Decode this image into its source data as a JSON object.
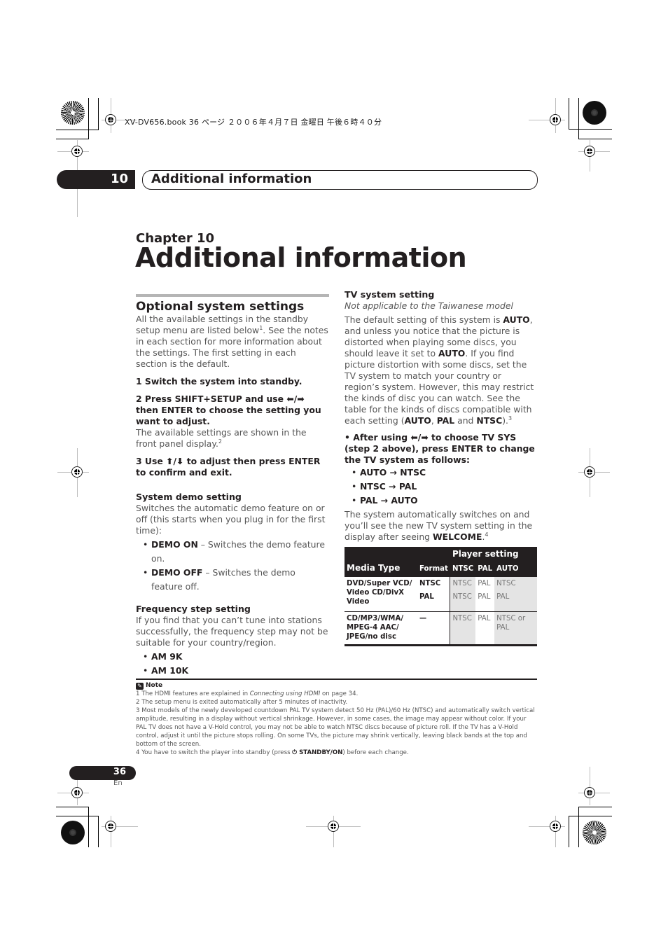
{
  "print_header": "XV-DV656.book  36 ページ  ２００６年４月７日  金曜日  午後６時４０分",
  "chapter_tab": {
    "number": "10",
    "title": "Additional information"
  },
  "chapter_heading": {
    "label": "Chapter 10",
    "title": "Additional information"
  },
  "left_column": {
    "section_title": "Optional system settings",
    "intro_a": "All the available settings in the standby setup menu are listed below",
    "intro_sup": "1",
    "intro_b": ". See the notes in each section for more information about the settings. The first setting in each section is the default.",
    "step1": "1    Switch the system into standby.",
    "step2": "2    Press SHIFT+SETUP and use ⬅/➡ then ENTER to choose the setting you want to adjust.",
    "step2_note_a": "The available settings are shown in the front panel display.",
    "step2_note_sup": "2",
    "step3": "3    Use ⬆/⬇ to adjust then press ENTER to confirm and exit.",
    "demo": {
      "title": "System demo setting",
      "desc": "Switches the automatic demo feature on or off (this starts when you plug in for the first time):",
      "options": [
        {
          "label": "DEMO ON",
          "desc": " – Switches the demo feature on."
        },
        {
          "label": "DEMO OFF",
          "desc": " – Switches the demo feature off."
        }
      ]
    },
    "freq": {
      "title": "Frequency step setting",
      "desc": "If you find that you can’t tune into stations successfully, the frequency step may not be suitable for your country/region.",
      "options": [
        "AM 9K",
        "AM 10K"
      ]
    }
  },
  "right_column": {
    "title": "TV system setting",
    "subtitle": "Not applicable to the Taiwanese model",
    "para": {
      "t1": "The default setting of this system is ",
      "b1": "AUTO",
      "t2": ", and unless you notice that the picture is distorted when playing some discs, you should leave it set to ",
      "b2": "AUTO",
      "t3": ". If you find picture distortion with some discs, set the TV system to match your country or region’s system. However, this may restrict the kinds of disc you can watch. See the table for the kinds of discs compatible with each setting (",
      "b3": "AUTO",
      "t4": ", ",
      "b4": "PAL",
      "t5": " and ",
      "b5": "NTSC",
      "t6": ").",
      "sup": "3"
    },
    "instruction": "•    After using ⬅/➡ to choose TV SYS (step 2 above), press ENTER to change the TV system as follows:",
    "cycle": [
      "AUTO → NTSC",
      "NTSC → PAL",
      "PAL → AUTO"
    ],
    "after": {
      "t1": "The system automatically switches on and you’ll see the new TV system setting in the display after seeing ",
      "b1": "WELCOME",
      "t2": ".",
      "sup": "4"
    },
    "table": {
      "group_header": "Player setting",
      "headers": [
        "Media Type",
        "Format",
        "NTSC",
        "PAL",
        "AUTO"
      ],
      "rows": [
        {
          "media": "DVD/Super VCD/ Video CD/DivX Video",
          "formats": [
            "NTSC",
            "PAL"
          ],
          "ntsc": [
            "NTSC",
            "NTSC"
          ],
          "pal": [
            "PAL",
            "PAL"
          ],
          "auto": [
            "NTSC",
            "PAL"
          ]
        },
        {
          "media": "CD/MP3/WMA/ MPEG-4 AAC/ JPEG/no disc",
          "formats": [
            "—"
          ],
          "ntsc": [
            "NTSC"
          ],
          "pal": [
            "PAL"
          ],
          "auto": [
            "NTSC or PAL"
          ]
        }
      ]
    }
  },
  "notes": {
    "title": "Note",
    "items": [
      {
        "pre": "1  The HDMI features are explained in ",
        "em": "Connecting using HDMI",
        "post": " on page 34."
      },
      {
        "pre": "2 The setup menu is exited automatically after 5 minutes of inactivity.",
        "em": "",
        "post": ""
      },
      {
        "pre": "3 Most models of the newly developed countdown PAL TV system detect 50 Hz (PAL)/60 Hz (NTSC) and automatically switch vertical amplitude, resulting in a display without vertical shrinkage. However, in some cases, the image may appear without color. If your PAL TV does not have a V-Hold control, you may not be able to watch NTSC discs because of picture roll. If the TV has a V-Hold control, adjust it until the picture stops rolling. On some TVs, the picture may shrink vertically, leaving black bands at the top and bottom of the screen.",
        "em": "",
        "post": ""
      },
      {
        "pre": "4 You have to switch the player into standby (press ",
        "icon": "⏻",
        "bold": " STANDBY/ON",
        "post": ") before each change."
      }
    ]
  },
  "footer": {
    "page_number": "36",
    "language": "En"
  }
}
